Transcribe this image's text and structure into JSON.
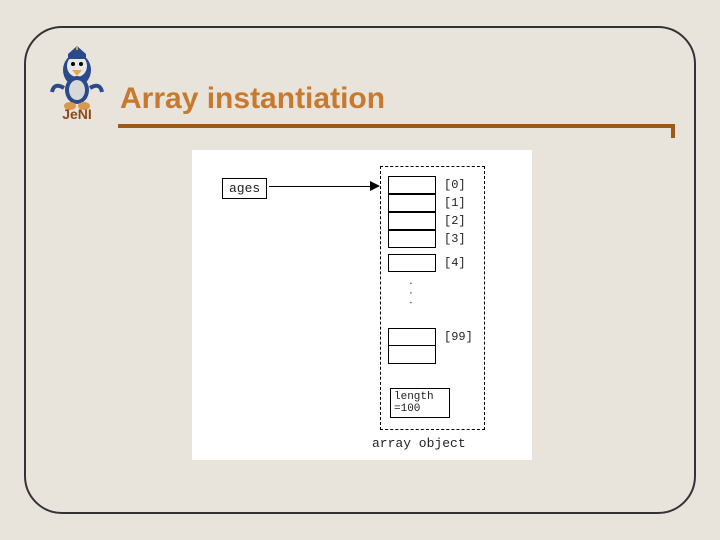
{
  "slide": {
    "title": "Array instantiation",
    "logo_text": "JeNI"
  },
  "diagram": {
    "variable_name": "ages",
    "indices": [
      "[0]",
      "[1]",
      "[2]",
      "[3]",
      "[4]",
      "[99]"
    ],
    "ellipsis": "...",
    "length_label": "length\n=100",
    "caption": "array object"
  }
}
